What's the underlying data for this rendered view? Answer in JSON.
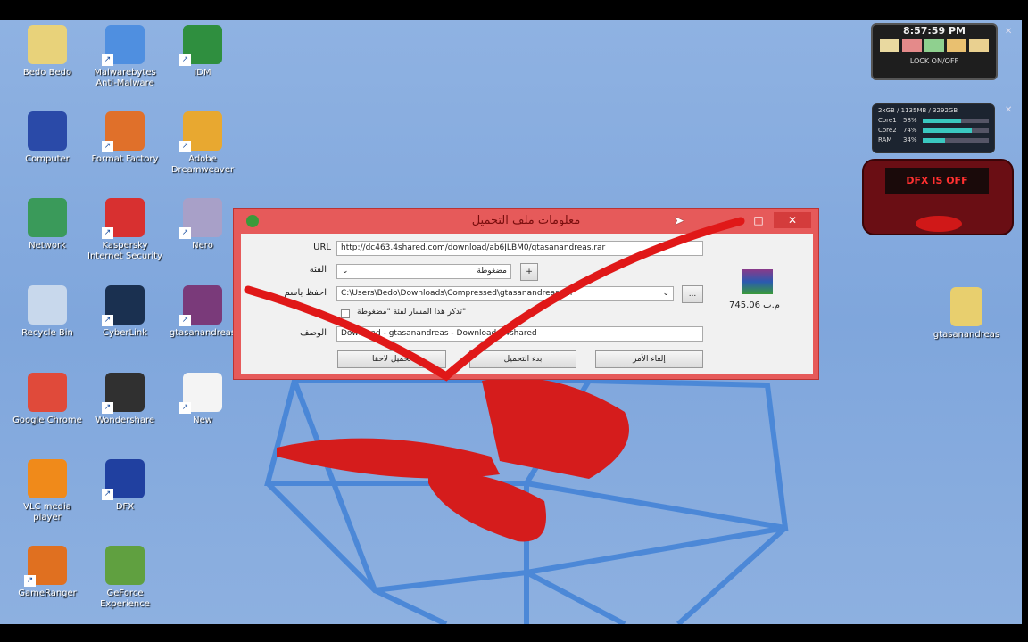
{
  "desktop_icons": [
    {
      "label": "Bedo Bedo",
      "color": "#e8d27a"
    },
    {
      "label": "Malwarebytes Anti-Malware",
      "color": "#4f8fe0"
    },
    {
      "label": "IDM",
      "color": "#2f8f3f"
    },
    {
      "label": "Computer",
      "color": "#2a4aa8"
    },
    {
      "label": "Format Factory",
      "color": "#e0702a"
    },
    {
      "label": "Adobe Dreamweaver",
      "color": "#e8a830"
    },
    {
      "label": "Network",
      "color": "#3a9a5a"
    },
    {
      "label": "Kaspersky Internet Security",
      "color": "#d83030"
    },
    {
      "label": "Nero",
      "color": "#a8a0c8"
    },
    {
      "label": "Recycle Bin",
      "color": "#c8d8ec"
    },
    {
      "label": "CyberLink",
      "color": "#1a3050"
    },
    {
      "label": "gtasanandreas",
      "color": "#7a3a7a"
    },
    {
      "label": "Google Chrome",
      "color": "#e04a3a"
    },
    {
      "label": "Wondershare",
      "color": "#303030"
    },
    {
      "label": "New",
      "color": "#f4f4f4"
    },
    {
      "label": "VLC media player",
      "color": "#f08a1a"
    },
    {
      "label": "DFX",
      "color": "#2040a0"
    },
    {
      "label": "GameRanger",
      "color": "#e07020"
    },
    {
      "label": "GeForce Experience",
      "color": "#60a040"
    }
  ],
  "right_icon": {
    "label": "gtasanandreas"
  },
  "dialog": {
    "title": "معلومات ملف التحميل",
    "url_label": "URL",
    "url_value": "http://dc463.4shared.com/download/ab6JLBM0/gtasanandreas.rar",
    "category_label": "الفئة",
    "category_value": "مضغوطة",
    "add_button": "+",
    "save_as_label": "احفظ باسم",
    "save_as_value": "C:\\Users\\Bedo\\Downloads\\Compressed\\gtasanandreas.rar",
    "browse_button": "...",
    "remember_label": "تذكر هذا المسار لفئة \"مضغوطة\"",
    "description_label": "الوصف",
    "description_value": "Download - gtasanandreas - Download - 4shared",
    "file_size": "745.06 م.ب",
    "buttons": {
      "later": "تحميل لاحقا",
      "start": "بدء التحميل",
      "cancel": "إلغاء الأمر"
    },
    "close": "✕",
    "maximize": "□",
    "minimize": "–"
  },
  "clock_gadget": {
    "time": "8:57:59 PM",
    "lock": "LOCK ON/OFF"
  },
  "monitor_gadget": {
    "header": "2xGB / 1135MB / 3292GB",
    "rows": [
      {
        "label": "Core1",
        "value": "58%",
        "fill": 0.58
      },
      {
        "label": "Core2",
        "value": "74%",
        "fill": 0.74
      },
      {
        "label": "RAM",
        "value": "34%",
        "fill": 0.34
      }
    ]
  },
  "dfx_gadget": {
    "display": "DFX IS OFF"
  }
}
